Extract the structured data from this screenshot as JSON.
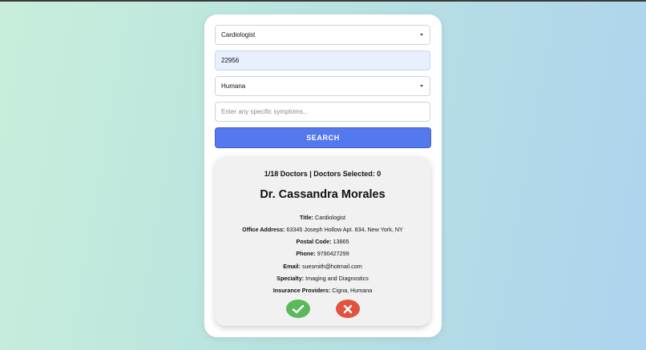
{
  "form": {
    "specialty_value": "Cardiologist",
    "zip_value": "22956",
    "insurance_value": "Humana",
    "symptoms_placeholder": "Enter any specific symptoms...",
    "search_label": "SEARCH"
  },
  "results": {
    "counter": "1/18 Doctors | Doctors Selected: 0",
    "doctor": {
      "name": "Dr. Cassandra Morales",
      "fields": [
        {
          "label": "Title:",
          "value": "Cardiologist"
        },
        {
          "label": "Office Address:",
          "value": "63345 Joseph Hollow Apt. 834, New York, NY"
        },
        {
          "label": "Postal Code:",
          "value": "13865"
        },
        {
          "label": "Phone:",
          "value": "9790427299"
        },
        {
          "label": "Email:",
          "value": "suesmith@hotmail.com"
        },
        {
          "label": "Specialty:",
          "value": "Imaging and Diagnostics"
        },
        {
          "label": "Insurance Providers:",
          "value": "Cigna, Humana"
        }
      ]
    }
  },
  "actions": {
    "accept_icon": "checkmark-icon",
    "reject_icon": "close-icon",
    "accept_color": "#5cb85c",
    "reject_color": "#e0533f"
  },
  "colors": {
    "search_button": "#5478ee",
    "card_background": "#f1f1f1"
  }
}
